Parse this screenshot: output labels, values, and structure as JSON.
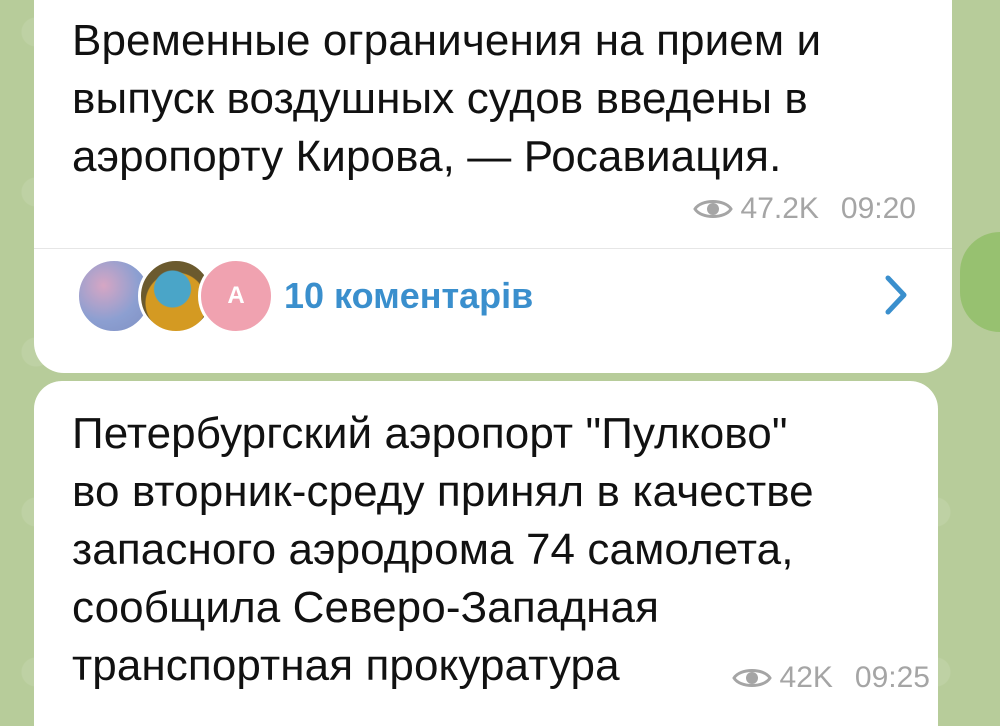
{
  "posts": [
    {
      "text": "Временные ограничения на прием и\nвыпуск воздушных судов введены в\nаэропорту Кирова, — Росавиация.",
      "views": "47.2K",
      "time": "09:20",
      "comments": {
        "label": "10 коментарів",
        "avatar_letter": "А"
      }
    },
    {
      "text": "Петербургский аэропорт \"Пулково\"\nво вторник-среду принял в качестве\nзапасного аэродрома 74 самолета,\nсообщила Северо-Западная\nтранспортная прокуратура",
      "views": "42K",
      "time": "09:25"
    }
  ],
  "colors": {
    "background": "#b7cc9a",
    "bubble": "#ffffff",
    "link": "#3a8fcd",
    "meta": "#a5a5a5"
  },
  "icons": {
    "views": "eye-icon",
    "open_comments": "chevron-right-icon"
  }
}
